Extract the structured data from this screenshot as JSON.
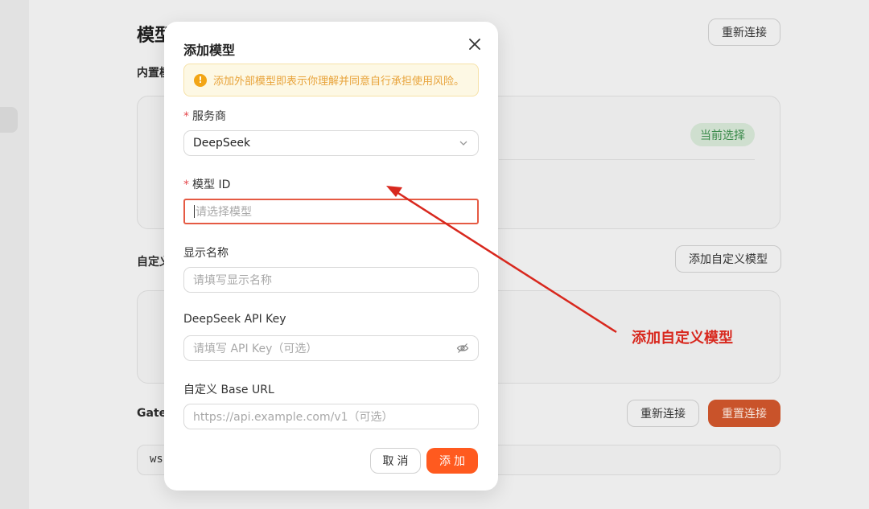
{
  "background": {
    "title": "模型",
    "subtitle": "内置模",
    "reconnect_top": "重新连接",
    "current_badge": "当前选择",
    "custom_section": "自定义",
    "add_custom_button": "添加自定义模型",
    "gateway_section": "Gate",
    "reconnect_button": "重新连接",
    "reset_button": "重置连接",
    "ws_text": "ws",
    "exclamation": "!"
  },
  "modal": {
    "title": "添加模型",
    "warning": "添加外部模型即表示你理解并同意自行承担使用风险。",
    "warning_icon": "!",
    "provider": {
      "label": "服务商",
      "required_mark": "*",
      "value": "DeepSeek"
    },
    "model_id": {
      "label": "模型 ID",
      "required_mark": "*",
      "placeholder": "请选择模型"
    },
    "display_name": {
      "label": "显示名称",
      "placeholder": "请填写显示名称"
    },
    "api_key": {
      "label": "DeepSeek API Key",
      "placeholder": "请填写 API Key（可选）"
    },
    "base_url": {
      "label": "自定义 Base URL",
      "placeholder": "https://api.example.com/v1（可选）"
    },
    "cancel_label": "取消",
    "add_label": "添加"
  },
  "annotation": {
    "text": "添加自定义模型",
    "color": "#d8281e"
  },
  "colors": {
    "accent": "#ff5a1f",
    "warning_bg": "#fdf8e4",
    "warning_text": "#e8a33a",
    "error_border": "#e55a43"
  }
}
